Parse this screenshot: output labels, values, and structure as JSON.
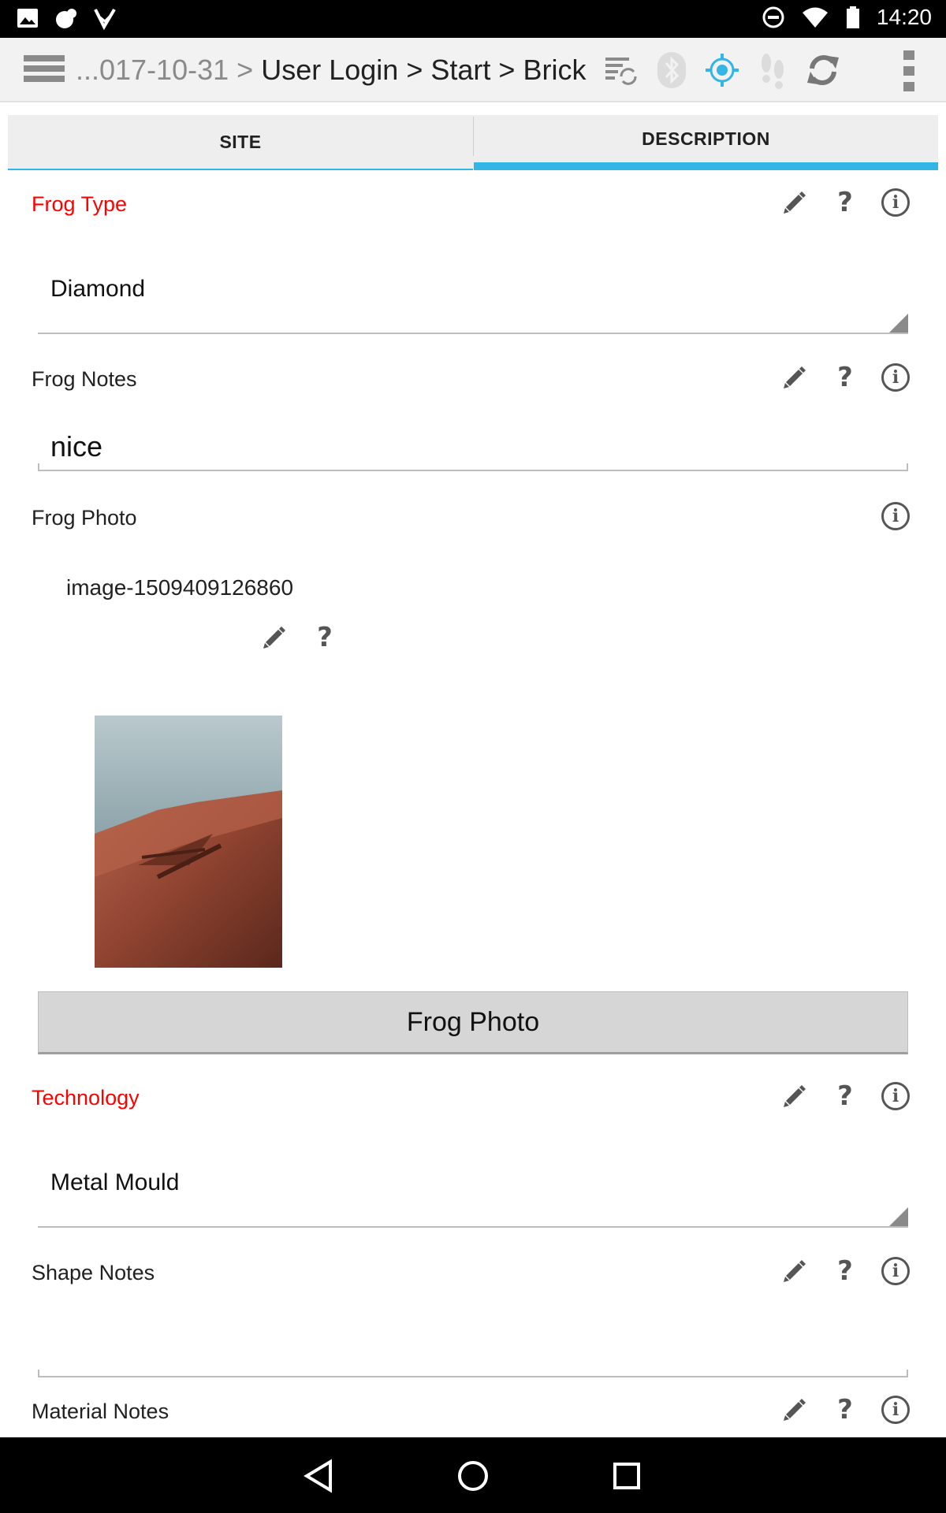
{
  "status_bar": {
    "time": "14:20",
    "left_icons": [
      "image-icon",
      "weather-icon",
      "checkmark-notification-icon"
    ],
    "right_icons": [
      "do-not-disturb-icon",
      "wifi-icon",
      "battery-icon"
    ]
  },
  "app_bar": {
    "breadcrumb": {
      "truncated": "...017-10-31",
      "sep": ">",
      "items": [
        "User Login",
        "Start",
        "Brick"
      ]
    },
    "icons": [
      "sync-settings-icon",
      "bluetooth-icon",
      "gps-target-icon",
      "footsteps-icon",
      "refresh-icon",
      "overflow-menu-icon"
    ],
    "colors": {
      "gps_active": "#33b5e5",
      "inactive": "#8a8a8a"
    }
  },
  "tabs": [
    {
      "label": "SITE",
      "active": false
    },
    {
      "label": "DESCRIPTION",
      "active": true
    }
  ],
  "fields": {
    "frog_type": {
      "label": "Frog Type",
      "value": "Diamond",
      "required": true
    },
    "frog_notes": {
      "label": "Frog Notes",
      "value": "nice"
    },
    "frog_photo": {
      "label": "Frog Photo",
      "image_name": "image-1509409126860",
      "button_label": "Frog Photo"
    },
    "technology": {
      "label": "Technology",
      "value": "Metal Mould",
      "required": true
    },
    "shape_notes": {
      "label": "Shape Notes",
      "value": ""
    },
    "material_notes": {
      "label": "Material Notes"
    }
  },
  "colors": {
    "accent": "#33b5e5",
    "required_label": "#ff0000"
  }
}
